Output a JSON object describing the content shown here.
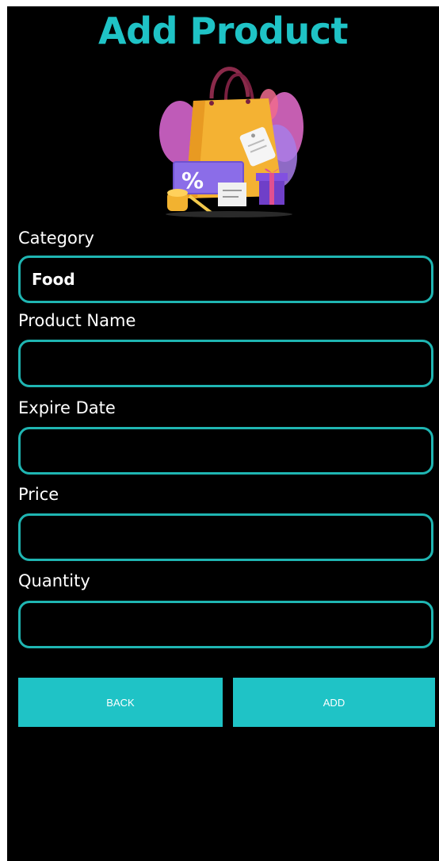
{
  "page": {
    "title": "Add Product"
  },
  "colors": {
    "accent": "#1fc3c6",
    "field_border": "#1fb5b2",
    "background": "#000000",
    "text": "#ffffff"
  },
  "illustration": {
    "icon": "shopping-bag-illustration",
    "badge_text": "%"
  },
  "form": {
    "category": {
      "label": "Category",
      "value": "Food"
    },
    "product_name": {
      "label": "Product Name",
      "value": ""
    },
    "expire_date": {
      "label": "Expire Date",
      "value": ""
    },
    "price": {
      "label": "Price",
      "value": ""
    },
    "quantity": {
      "label": "Quantity",
      "value": ""
    }
  },
  "buttons": {
    "back_label": "BACK",
    "add_label": "ADD"
  }
}
